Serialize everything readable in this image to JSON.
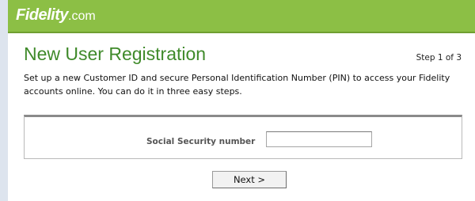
{
  "header": {
    "logo_main": "Fidelity",
    "logo_suffix": ".com",
    "accent": "#8cbf45"
  },
  "registration": {
    "title": "New User Registration",
    "step": "Step 1 of 3",
    "description": "Set up a new Customer ID and secure Personal Identification Number (PIN) to access your Fidelity accounts online. You can do it in three easy steps.",
    "ssn_label": "Social Security number",
    "ssn_value": "",
    "next_label": "Next >"
  }
}
